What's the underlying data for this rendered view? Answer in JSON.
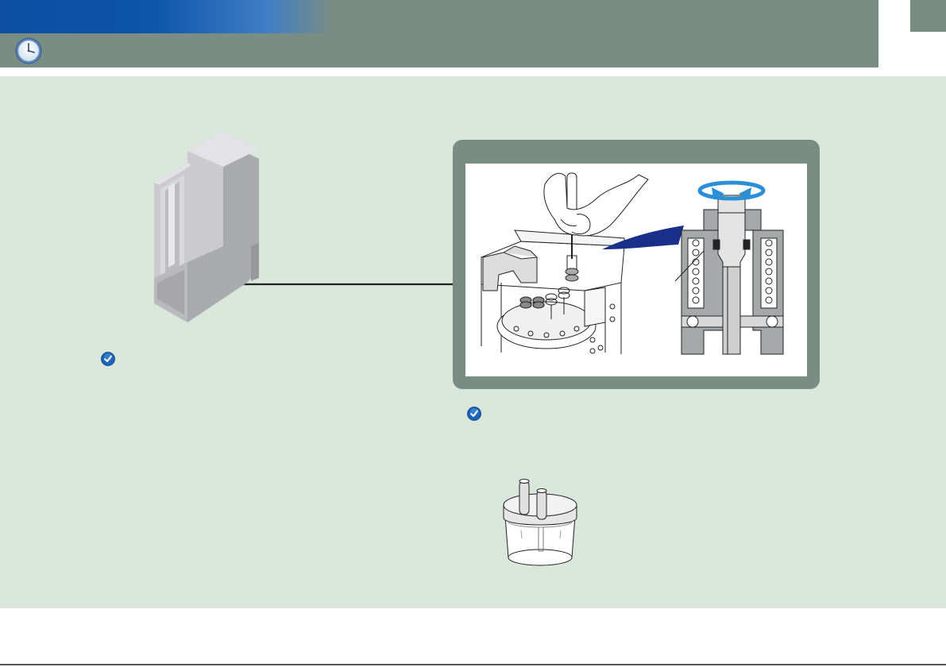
{
  "icons": {
    "header": "clock-icon",
    "module": "device-module-icon",
    "checks": [
      "checkmark-icon",
      "checkmark-icon"
    ],
    "cartridge": "cartridge-vial-icon",
    "screwdriver": "screwdriver-hand-icon",
    "rotate": "rotate-arrows-icon"
  },
  "colors": {
    "header_bg": "#7a8d84",
    "banner_blue": "#0b4ea2",
    "content_bg": "#d8e6dc",
    "accent_blue": "#1a63b8",
    "panel_bg": "#7a8d84"
  }
}
